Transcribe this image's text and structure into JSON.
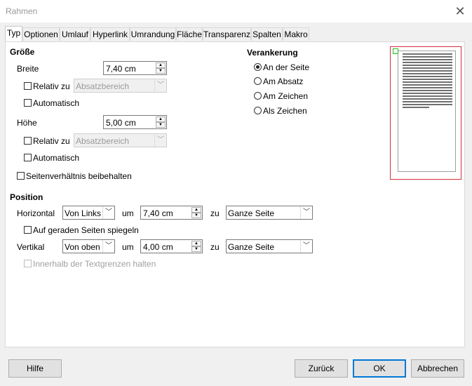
{
  "window": {
    "title": "Rahmen"
  },
  "tabs": [
    {
      "label": "Typ",
      "active": true
    },
    {
      "label": "Optionen"
    },
    {
      "label": "Umlauf"
    },
    {
      "label": "Hyperlink"
    },
    {
      "label": "Umrandung"
    },
    {
      "label": "Fläche"
    },
    {
      "label": "Transparenz"
    },
    {
      "label": "Spalten"
    },
    {
      "label": "Makro"
    }
  ],
  "size": {
    "section_label": "Größe",
    "width_label": "Breite",
    "width_value": "7,40 cm",
    "width_relative_label": "Relativ zu",
    "width_relative_value": "Absatzbereich",
    "width_auto_label": "Automatisch",
    "height_label": "Höhe",
    "height_value": "5,00 cm",
    "height_relative_label": "Relativ zu",
    "height_relative_value": "Absatzbereich",
    "height_auto_label": "Automatisch",
    "keep_ratio_label": "Seitenverhältnis beibehalten"
  },
  "anchor": {
    "section_label": "Verankerung",
    "options": [
      "An der Seite",
      "Am Absatz",
      "Am Zeichen",
      "Als Zeichen"
    ],
    "selected": "An der Seite"
  },
  "position": {
    "section_label": "Position",
    "horizontal_label": "Horizontal",
    "horizontal_value": "Von Links",
    "horizontal_by_label": "um",
    "horizontal_by_value": "7,40 cm",
    "horizontal_to_label": "zu",
    "horizontal_to_value": "Ganze Seite",
    "mirror_label": "Auf geraden Seiten spiegeln",
    "vertical_label": "Vertikal",
    "vertical_value": "Von oben",
    "vertical_by_label": "um",
    "vertical_by_value": "4,00 cm",
    "vertical_to_label": "zu",
    "vertical_to_value": "Ganze Seite",
    "keep_inside_label": "Innerhalb der Textgrenzen halten"
  },
  "buttons": {
    "help": "Hilfe",
    "reset": "Zurück",
    "ok": "OK",
    "cancel": "Abbrechen"
  },
  "colors": {
    "preview_border": "#d0303a",
    "anchor_marker": "#22c022",
    "default_button_border": "#0078d7"
  }
}
